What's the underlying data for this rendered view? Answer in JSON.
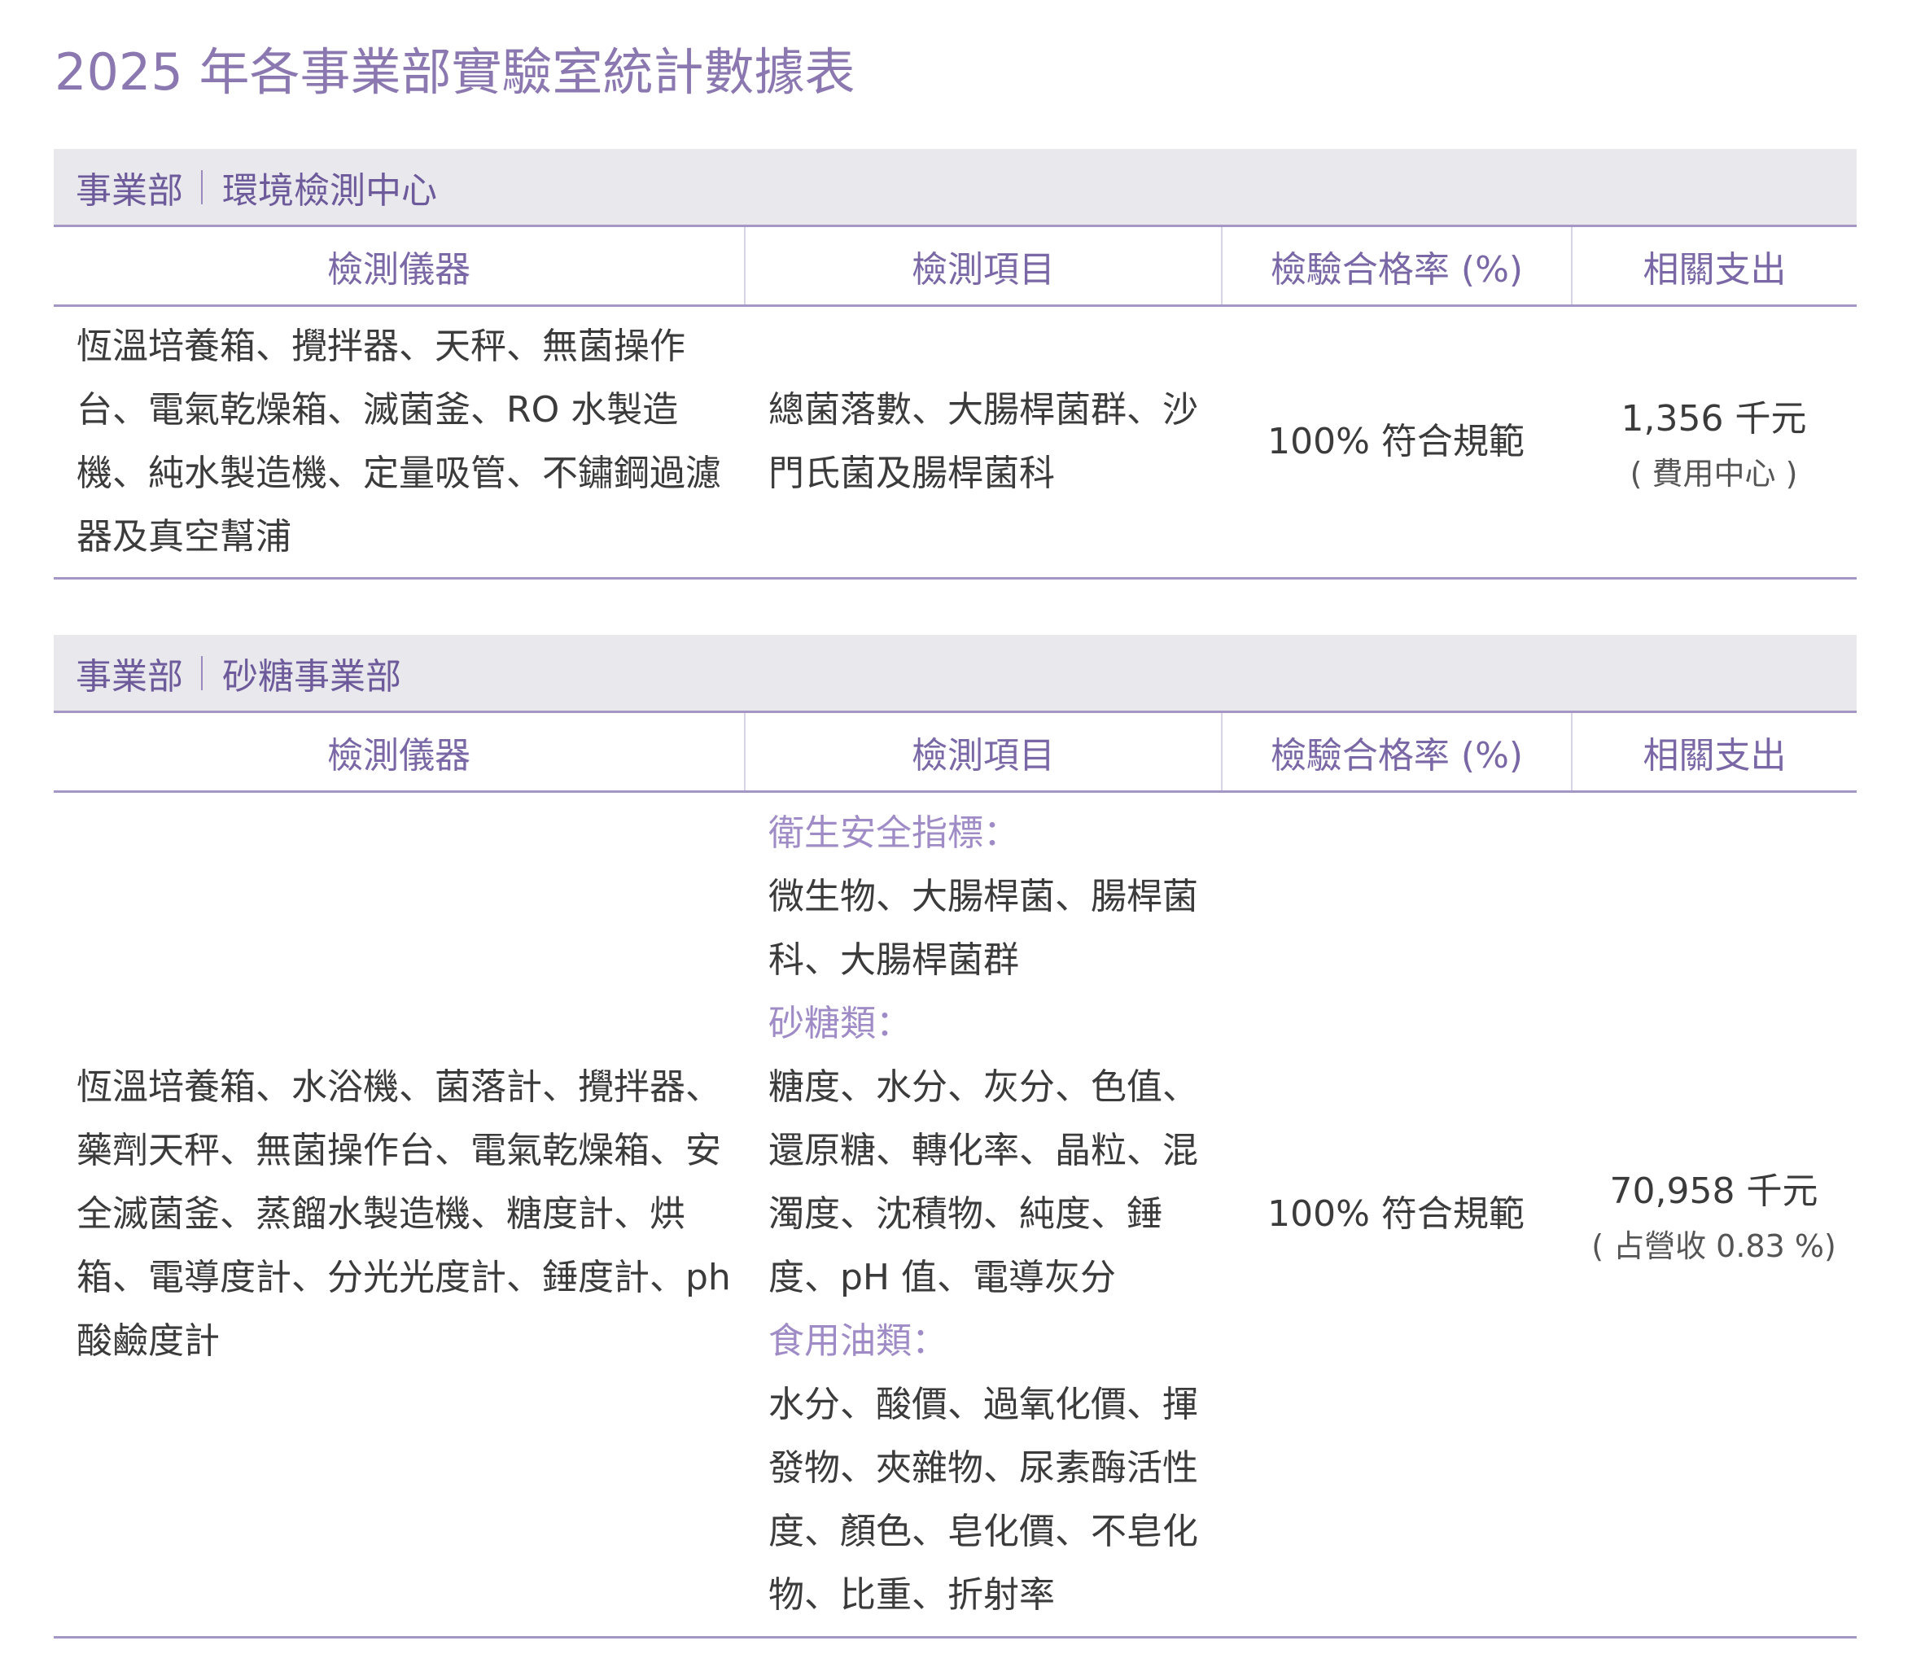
{
  "title": "2025 年各事業部實驗室統計數據表",
  "colors": {
    "accent": "#8b78b0",
    "header_bar_bg": "#e9e8ed",
    "rule": "#a597c5",
    "category_label": "#9f8cc6"
  },
  "sections": [
    {
      "dept_prefix": "事業部",
      "dept_name": "環境檢測中心",
      "headers": [
        "檢測儀器",
        "檢測項目",
        "檢驗合格率 (%)",
        "相關支出"
      ],
      "instruments": "恆溫培養箱、攪拌器、天秤、無菌操作台、電氣乾燥箱、滅菌釜、RO 水製造機、純水製造機、定量吸管、不鏽鋼過濾器及真空幫浦",
      "items": "總菌落數、大腸桿菌群、沙門氏菌及腸桿菌科",
      "pass_rate": "100% 符合規範",
      "expense": "1,356 千元",
      "expense_note": "( 費用中心 )"
    },
    {
      "dept_prefix": "事業部",
      "dept_name": "砂糖事業部",
      "headers": [
        "檢測儀器",
        "檢測項目",
        "檢驗合格率 (%)",
        "相關支出"
      ],
      "instruments": "恆溫培養箱、水浴機、菌落計、攪拌器、藥劑天秤、無菌操作台、電氣乾燥箱、安全滅菌釜、蒸餾水製造機、糖度計、烘箱、電導度計、分光光度計、錘度計、ph 酸鹼度計",
      "item_categories": [
        {
          "label": "衛生安全指標：",
          "items": "微生物、大腸桿菌、腸桿菌科、大腸桿菌群"
        },
        {
          "label": "砂糖類：",
          "items": "糖度、水分、灰分、色值、還原糖、轉化率、晶粒、混濁度、沈積物、純度、錘度、pH 值、電導灰分"
        },
        {
          "label": "食用油類：",
          "items": "水分、酸價、過氧化價、揮發物、夾雜物、尿素酶活性度、顏色、皂化價、不皂化物、比重、折射率"
        }
      ],
      "pass_rate": "100% 符合規範",
      "expense": "70,958 千元",
      "expense_note": "( 占營收 0.83 %)"
    }
  ]
}
